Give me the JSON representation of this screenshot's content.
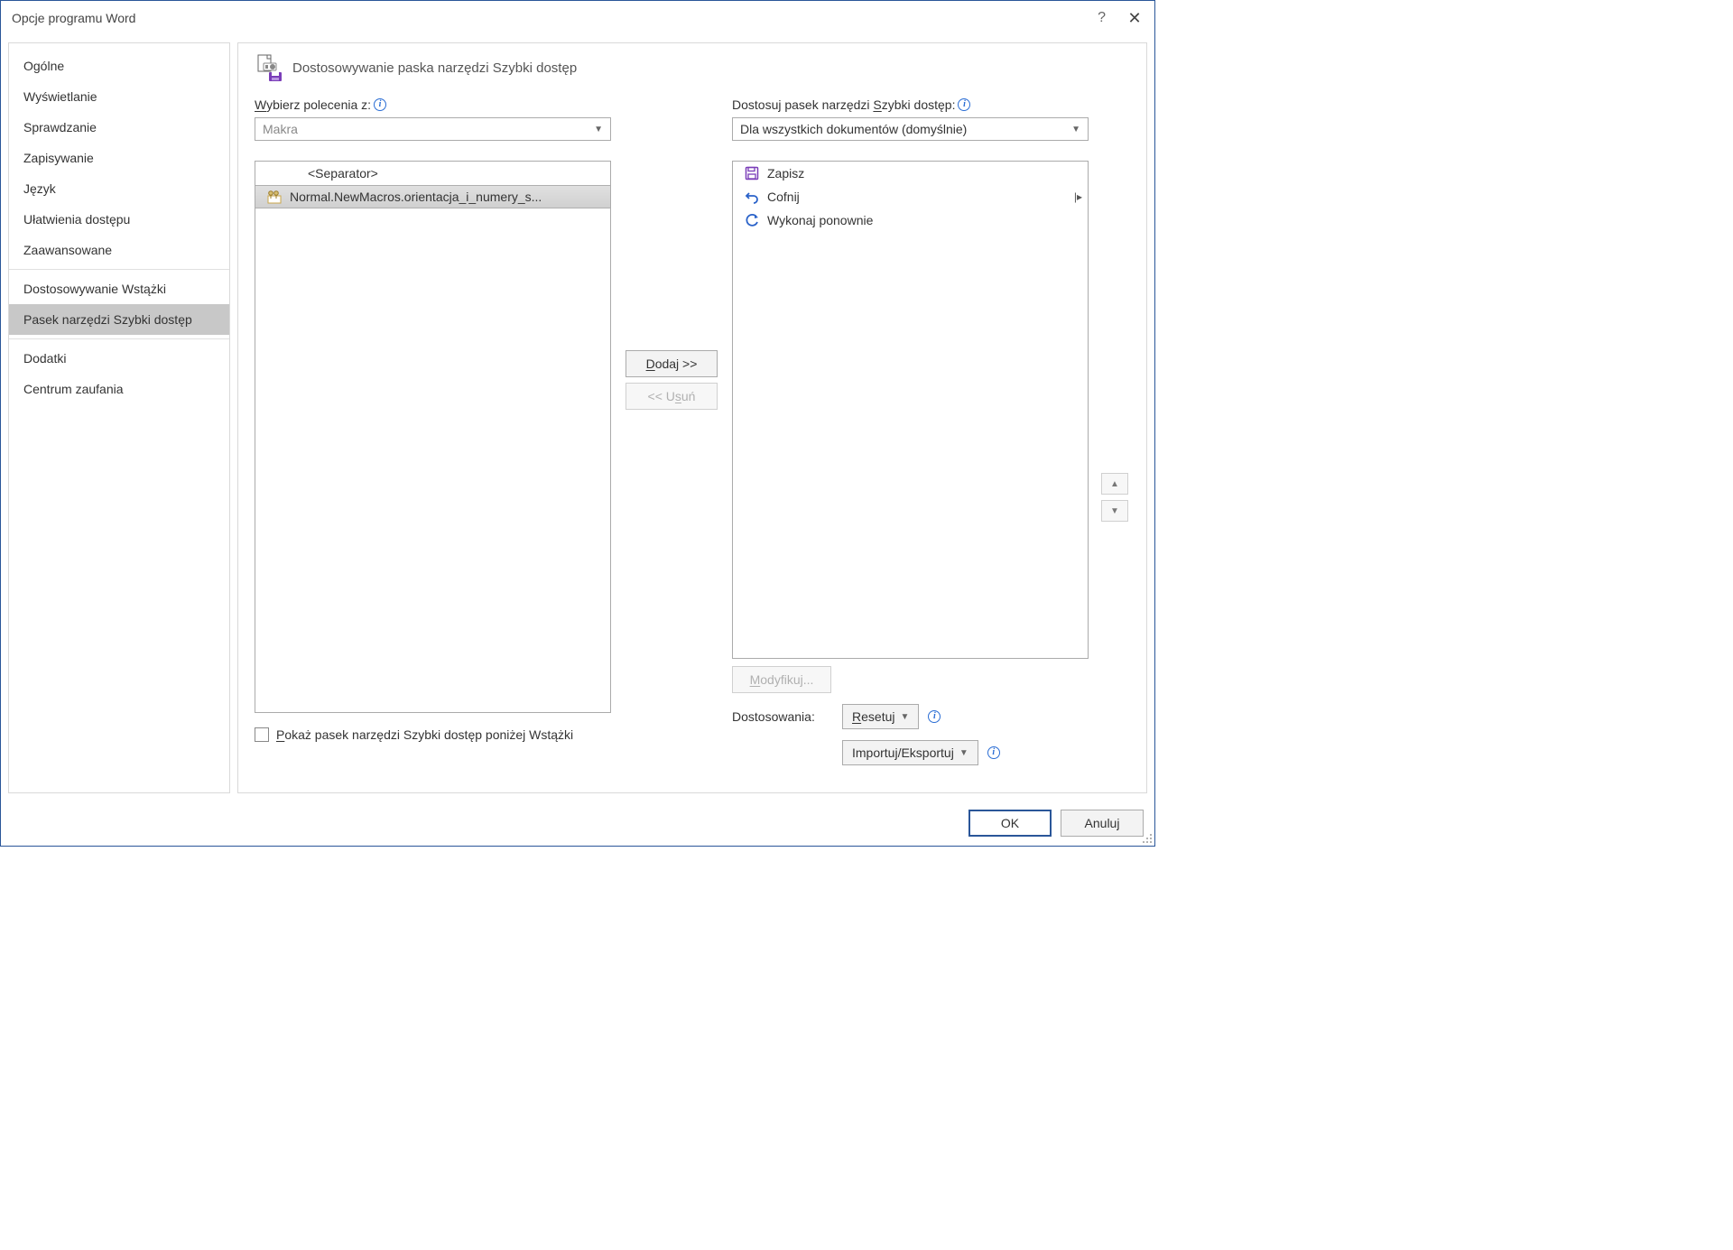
{
  "window": {
    "title": "Opcje programu Word"
  },
  "sidebar": {
    "items": [
      {
        "label": "Ogólne"
      },
      {
        "label": "Wyświetlanie"
      },
      {
        "label": "Sprawdzanie"
      },
      {
        "label": "Zapisywanie"
      },
      {
        "label": "Język"
      },
      {
        "label": "Ułatwienia dostępu"
      },
      {
        "label": "Zaawansowane"
      },
      {
        "label": "Dostosowywanie Wstążki"
      },
      {
        "label": "Pasek narzędzi Szybki dostęp",
        "selected": true
      },
      {
        "label": "Dodatki"
      },
      {
        "label": "Centrum zaufania"
      }
    ]
  },
  "main": {
    "heading": "Dostosowywanie paska narzędzi Szybki dostęp",
    "left_label": "Wybierz polecenia z:",
    "left_select_value": "Makra",
    "right_label": "Dostosuj pasek narzędzi Szybki dostęp:",
    "right_select_value": "Dla wszystkich dokumentów (domyślnie)",
    "left_list": {
      "separator": "<Separator>",
      "macro": "Normal.NewMacros.orientacja_i_numery_s..."
    },
    "right_list": {
      "save": "Zapisz",
      "undo": "Cofnij",
      "redo": "Wykonaj ponownie"
    },
    "add_label": "Dodaj >>",
    "remove_label": "<< Usuń",
    "modify_label": "Modyfikuj...",
    "custom_label": "Dostosowania:",
    "reset_label": "Resetuj",
    "import_label": "Importuj/Eksportuj",
    "checkbox_label": "Pokaż pasek narzędzi Szybki dostęp poniżej Wstążki"
  },
  "footer": {
    "ok": "OK",
    "cancel": "Anuluj"
  }
}
